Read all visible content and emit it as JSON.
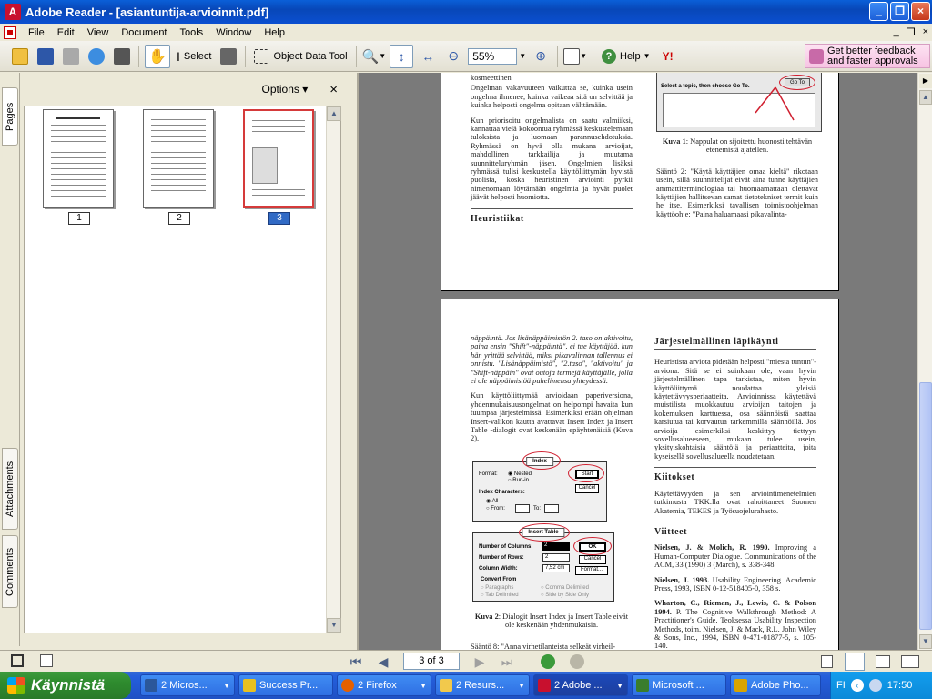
{
  "window": {
    "title": "Adobe Reader - [asiantuntija-arvioinnit.pdf]"
  },
  "menu": [
    "File",
    "Edit",
    "View",
    "Document",
    "Tools",
    "Window",
    "Help"
  ],
  "toolbar": {
    "select_label": "Select",
    "object_data_label": "Object Data Tool",
    "zoom_value": "55%",
    "help_label": "Help",
    "feedback_line1": "Get better feedback",
    "feedback_line2": "and faster approvals"
  },
  "nav_tabs": {
    "pages": "Pages",
    "attachments": "Attachments",
    "comments": "Comments"
  },
  "pages_panel": {
    "options_label": "Options",
    "close_glyph": "×",
    "thumbnails": [
      {
        "label": "1",
        "active": false
      },
      {
        "label": "2",
        "active": false
      },
      {
        "label": "3",
        "active": true
      }
    ]
  },
  "page_a": {
    "left_text_top": "kosmeettinen",
    "left_p1": "Ongelman vakavuuteen vaikuttaa se, kuinka usein ongelma ilmenee, kuinka vaikeaa sitä on selvittää ja kuinka helposti ongelma opitaan välttämään.",
    "left_p2": "Kun priorisoitu ongelmalista on saatu valmiiksi, kannattaa vielä kokoontua ryhmässä keskustelemaan tuloksista ja luomaan parannusehdotuksia. Ryhmässä on hyvä olla mukana arvioijat, mahdollinen tarkkailija ja muutama suunnitteluryhmän jäsen. Ongelmien lisäksi ryhmässä tulisi keskustella käyttöliittymän hyvistä puolista, koska heuristinen arviointi pyrkii nimenomaan löytämään ongelmia ja hyvät puolet jäävät helposti huomiotta.",
    "heading": "Heuristiikat",
    "fig_caption_top": "Select a topic, then choose Go To.",
    "fig_goto": "Go To",
    "fig1_caption_bold": "Kuva 1",
    "fig1_caption": ": Nappulat on sijoitettu huonosti tehtävän etenemistä ajatellen.",
    "right_p": "Sääntö 2: \"Käytä käyttäjien omaa kieltä\" rikotaan usein, sillä suunnittelijat eivät aina tunne käyttäjien ammattiterminologiaa tai huomaamattaan olettavat käyttäjien hallitsevan samat tietotekniset termit kuin he itse. Esimerkiksi tavallisen toimistoohjelman käyttöohje: \"Paina haluamaasi pikavalinta-"
  },
  "page_b": {
    "left_p1": "näppäintä. Jos lisänäppäimistön 2. taso on aktivoitu, paina ensin \"Shift\"-näppäintä\", ei tue käyttäjää, kun hän yrittää selvittää, miksi pikavalinnan tallennus ei onnistu. \"Lisänäppäimistö\", \"2.taso\", \"aktivoitu\" ja \"Shift-näppäin\" ovat outoja termejä käyttäjälle, jolla ei ole näppäimistöä puhelimensa yhteydessä.",
    "left_p2": "Kun käyttöliittymää arvioidaan paperiversiona, yhdenmukaisuusongelmat on helpompi havaita kun tuumpaa järjestelmissä. Esimerkiksi erään ohjelman Insert-valikon kautta avattavat Insert Index ja Insert Table -dialogit ovat keskenään epäyhtenäisiä (Kuva 2).",
    "dialog_index": {
      "title": "Index",
      "format_label": "Format:",
      "nested": "Nested",
      "runin": "Run-in",
      "start": "Start",
      "cancel": "Cancel",
      "chars_label": "Index Characters:",
      "all": "All",
      "from": "From:",
      "to": "To:"
    },
    "dialog_table": {
      "title": "Insert Table",
      "cols_label": "Number of Columns:",
      "cols_val": "2",
      "rows_label": "Number of Rows:",
      "rows_val": "2",
      "width_label": "Column Width:",
      "width_val": "7,52 cm",
      "ok": "OK",
      "cancel": "Cancel",
      "format": "Format...",
      "convert_from": "Convert From",
      "paragraphs": "Paragraphs",
      "comma": "Comma Delimited",
      "tab": "Tab Delimited",
      "side": "Side by Side Only"
    },
    "fig2_caption_bold": "Kuva 2",
    "fig2_caption": ": Dialogit Insert Index ja Insert Table eivät ole keskenään yhdenmukaisia.",
    "left_bottom": "Sääntö 8: \"Anna virhetilanteista selkeät virheil-",
    "r_heading1": "Järjestelmällinen läpikäynti",
    "r_p1": "Heuristista arviota pidetään helposti \"miesta tuntun\"-arviona. Sitä se ei suinkaan ole, vaan hyvin järjestelmällinen tapa tarkistaa, miten hyvin käyttöliittymä noudattaa yleisiä käytettävyysperiaatteita. Arvioinnissa käytettävä muistilista muokkautuu arvioijan taitojen ja kokemuksen karttuessa, osa säännöistä saattaa karsiutua tai korvautua tarkemmilla säännöillä. Jos arvioija esimerkiksi keskittyy tiettyyn sovellusalueeseen, mukaan tulee usein, yksityiskohtaisia sääntöjä ja periaatteita, joita kyseisellä sovellusalueella noudatetaan.",
    "r_heading2": "Kiitokset",
    "r_p2": "Käytettävyyden ja sen arviointimenetelmien tutkimusta TKK:lla ovat rahoittaneet Suomen Akatemia, TEKES ja Työsuojelurahasto.",
    "r_heading3": "Viitteet",
    "refs": [
      {
        "bold": "Nielsen, J. & Molich, R. 1990.",
        "text": " Improving a Human-Computer Dialogue. Communications of the ACM, 33 (1990) 3 (March), s. 338-348."
      },
      {
        "bold": "Nielsen, J. 1993.",
        "text": " Usability Engineering. Academic Press, 1993, ISBN 0-12-518405-0, 358 s."
      },
      {
        "bold": "Wharton, C., Rieman, J., Lewis, C. & Polson 1994.",
        "text": " P. The Cognitive Walkthrough Method: A Practitioner's Guide. Teoksessa Usability Inspection Methods, toim. Nielsen, J. & Mack, R.L. John Wiley & Sons, Inc., 1994, ISBN 0-471-01877-5, s. 105-140."
      }
    ]
  },
  "status": {
    "page_field": "3 of 3"
  },
  "taskbar": {
    "start_label": "Käynnistä",
    "tasks": [
      {
        "label": "2 Micros...",
        "color": "#2b579a"
      },
      {
        "label": "Success Pr...",
        "color": "#e8c020"
      },
      {
        "label": "2 Firefox",
        "color": "#e66000"
      },
      {
        "label": "2 Resurs...",
        "color": "#f2c94c"
      },
      {
        "label": "2 Adobe ...",
        "color": "#c8102e"
      },
      {
        "label": "Microsoft ...",
        "color": "#3a7d2c"
      },
      {
        "label": "Adobe Pho...",
        "color": "#d9a400"
      }
    ],
    "lang": "FI",
    "clock": "17:50"
  }
}
